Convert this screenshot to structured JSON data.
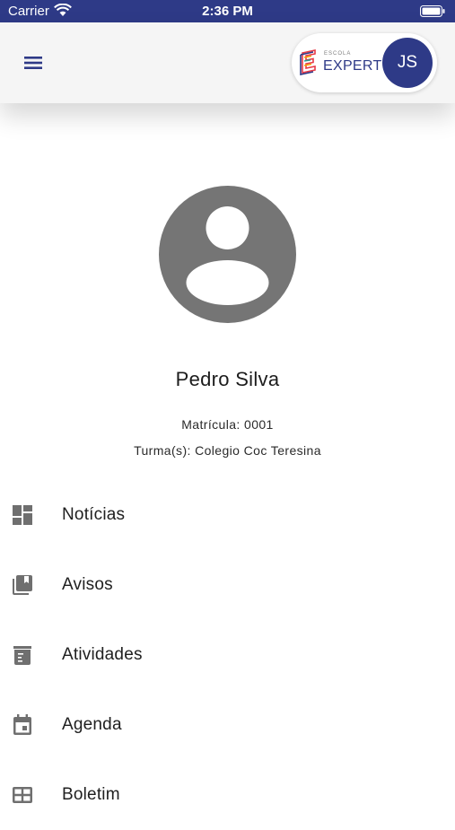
{
  "status_bar": {
    "carrier": "Carrier",
    "time": "2:36 PM",
    "icons": [
      "wifi-icon",
      "battery-icon"
    ]
  },
  "header": {
    "menu_icon": "hamburger-menu-icon",
    "logo_small_text": "ESCOLA",
    "logo_text": "EXPERT",
    "avatar_initials": "JS",
    "brand_color": "#2e3a87"
  },
  "profile": {
    "avatar_icon": "account-circle-icon",
    "name": "Pedro Silva",
    "registration": "Matrícula: 0001",
    "classes": "Turma(s): Colegio Coc Teresina"
  },
  "menu": {
    "items": [
      {
        "label": "Notícias",
        "icon": "dashboard-icon"
      },
      {
        "label": "Avisos",
        "icon": "library-books-icon"
      },
      {
        "label": "Atividades",
        "icon": "assignment-icon"
      },
      {
        "label": "Agenda",
        "icon": "calendar-event-icon"
      },
      {
        "label": "Boletim",
        "icon": "grid-table-icon"
      }
    ]
  },
  "colors": {
    "accent": "#2e3a87",
    "icon_gray": "#6f6f6f",
    "avatar_gray": "#757575"
  }
}
